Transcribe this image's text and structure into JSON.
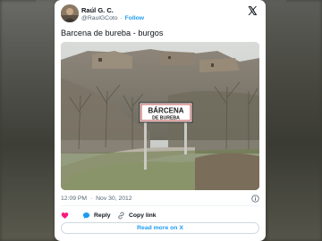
{
  "tweet": {
    "author_name": "Raúl G. C.",
    "handle": "@RaulGCoto",
    "separator": "·",
    "follow_label": "Follow",
    "text": "Barcena de bureba - burgos",
    "time": "12:09 PM",
    "date": "Nov 30, 2012",
    "date_separator": "·"
  },
  "photo": {
    "sign_line1": "BÁRCENA",
    "sign_line2": "DE BUREBA"
  },
  "actions": {
    "reply_label": "Reply",
    "copy_link_label": "Copy link",
    "read_more_label": "Read more on X"
  },
  "colors": {
    "accent": "#1d9bf0",
    "like": "#f91880",
    "text_primary": "#0f1419",
    "text_secondary": "#536471"
  },
  "icons": {
    "brand": "x-logo-icon",
    "like": "heart-icon",
    "reply": "speech-bubble-icon",
    "copy": "link-icon",
    "info": "info-icon"
  }
}
